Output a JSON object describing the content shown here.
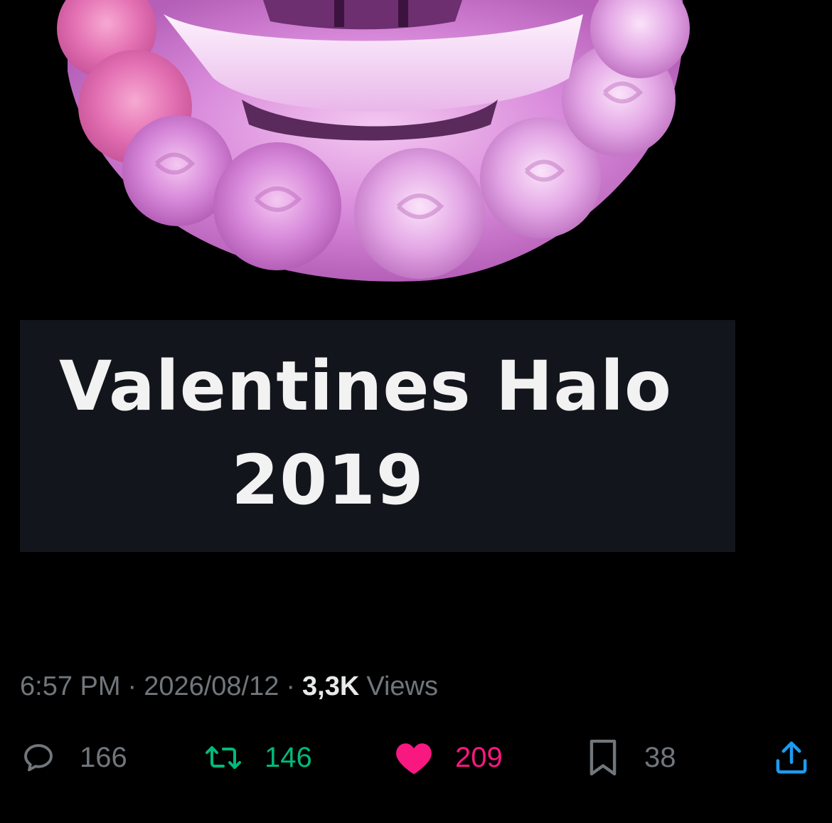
{
  "post": {
    "image": {
      "title_line1": "Valentines Halo",
      "title_line2": "2019"
    },
    "meta": {
      "time": "6:57 PM",
      "separator": "·",
      "date": "2026/08/12",
      "views_count": "3,3K",
      "views_label": "Views"
    },
    "actions": {
      "reply": {
        "icon": "reply-icon",
        "count": "166"
      },
      "repost": {
        "icon": "repost-icon",
        "count": "146",
        "color": "#00ba7c"
      },
      "like": {
        "icon": "heart-icon",
        "count": "209",
        "color": "#f91880",
        "liked": true
      },
      "bookmark": {
        "icon": "bookmark-icon",
        "count": "38"
      },
      "share": {
        "icon": "share-icon",
        "color": "#1d9bf0"
      }
    }
  },
  "colors": {
    "background": "#000000",
    "muted_text": "#71767b",
    "primary_text": "#e7e9ea",
    "banner": "#12151b"
  }
}
